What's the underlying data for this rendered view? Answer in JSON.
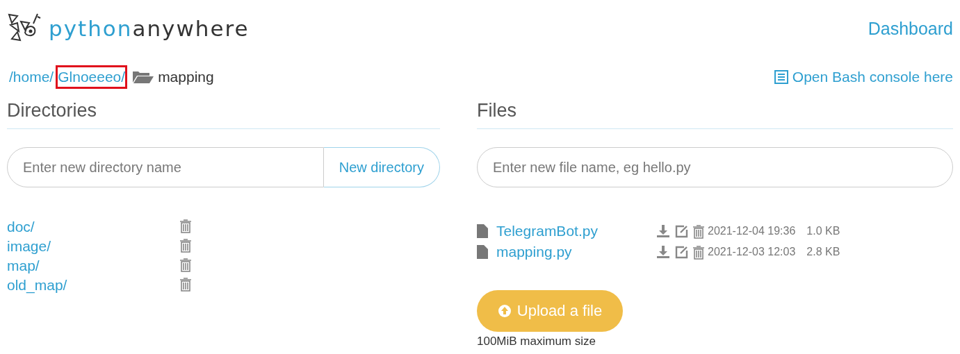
{
  "header": {
    "logo": {
      "part_1": "python",
      "part_2": "anywhere"
    },
    "nav_link": "Dashboard"
  },
  "breadcrumb": {
    "items": [
      {
        "text": "/home/",
        "highlighted": false
      },
      {
        "text": "Glnoeeeo/",
        "highlighted": true
      }
    ],
    "current": "mapping"
  },
  "bash_link": "Open Bash console here",
  "directories": {
    "heading": "Directories",
    "input": {
      "placeholder": "Enter new directory name"
    },
    "button": "New directory",
    "items": [
      "doc/",
      "image/",
      "map/",
      "old_map/"
    ]
  },
  "files": {
    "heading": "Files",
    "input": {
      "placeholder": "Enter new file name, eg hello.py"
    },
    "items": [
      {
        "name": "TelegramBot.py",
        "modified": "2021-12-04 19:36",
        "size": "1.0 KB"
      },
      {
        "name": "mapping.py",
        "modified": "2021-12-03 12:03",
        "size": "2.8 KB"
      }
    ],
    "upload_button": "Upload a file",
    "upload_note": "100MiB maximum size"
  }
}
